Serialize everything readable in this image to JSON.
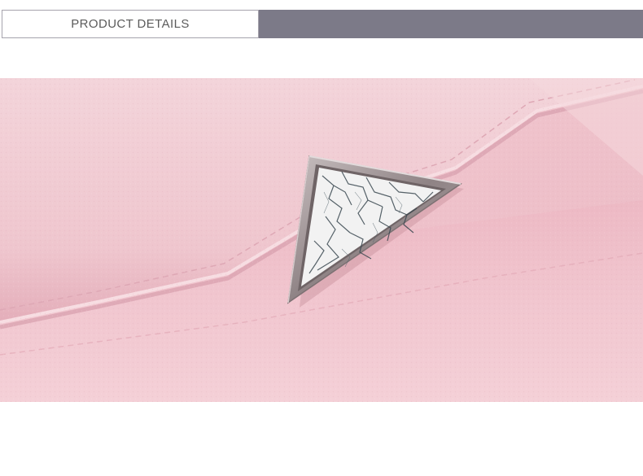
{
  "banner": {
    "title": "PRODUCT DETAILS"
  },
  "colors": {
    "banner_bar": "#7c7a88",
    "banner_border": "#a6a3ad",
    "banner_text": "#5b5b5b",
    "leather_pink": "#efc6cf",
    "hardware_metal": "#9b8f91",
    "stone_white": "#f2f2f2",
    "stone_veins": "#3a4850"
  },
  "photo": {
    "subject": "pink-leather-wallet-with-triangle-marble-clasp"
  }
}
